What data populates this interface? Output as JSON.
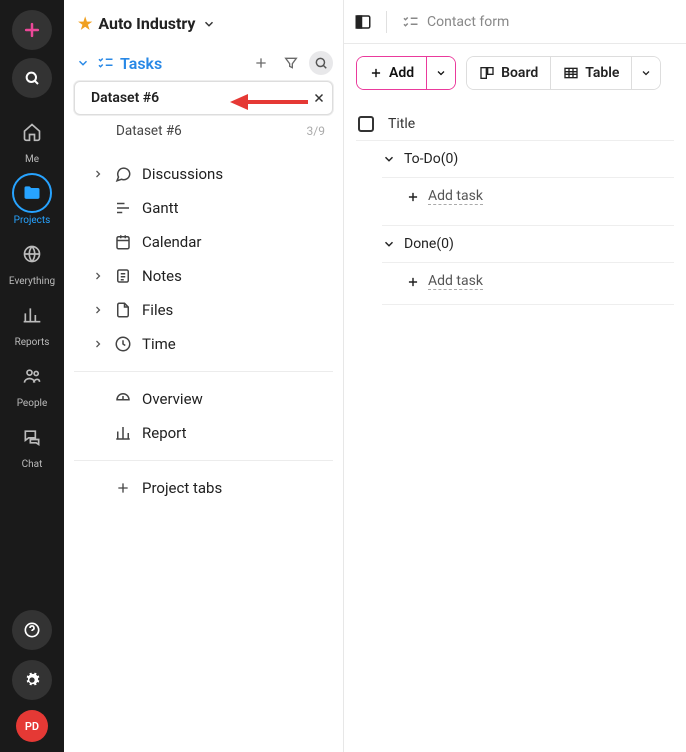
{
  "rail": {
    "me": "Me",
    "projects": "Projects",
    "everything": "Everything",
    "reports": "Reports",
    "people": "People",
    "chat": "Chat",
    "avatar": "PD"
  },
  "project": {
    "title": "Auto Industry"
  },
  "tasks_section": {
    "label": "Tasks",
    "dataset_active": "Dataset #6",
    "dataset_child": "Dataset #6",
    "child_count": "3/9"
  },
  "nav": {
    "discussions": "Discussions",
    "gantt": "Gantt",
    "calendar": "Calendar",
    "notes": "Notes",
    "files": "Files",
    "time": "Time",
    "overview": "Overview",
    "report": "Report",
    "project_tabs": "Project tabs"
  },
  "topbar": {
    "contact_form": "Contact form"
  },
  "controls": {
    "add": "Add",
    "board": "Board",
    "table": "Table"
  },
  "list": {
    "title_col": "Title",
    "todo": "To-Do",
    "todo_count": "(0)",
    "done": "Done",
    "done_count": "(0)",
    "add_task": "Add task"
  }
}
